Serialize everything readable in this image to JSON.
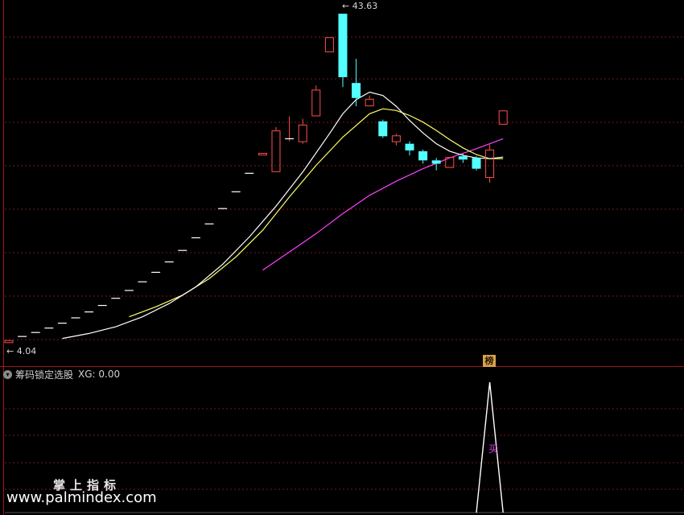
{
  "main_panel": {
    "high_label": "43.63",
    "low_label": "4.04"
  },
  "indicator": {
    "name": "筹码锁定选股",
    "value_label": "XG: 0.00",
    "badge": "榜",
    "signal_label": "买"
  },
  "watermark": {
    "line1": "掌上指标",
    "line2": "www.palmindex.com"
  },
  "colors": {
    "up": "#ff4d4d",
    "down": "#54ffff",
    "ma_short": "#ffffff",
    "ma_mid": "#ffff66",
    "ma_long": "#ff40ff",
    "grid": "#7a1a1a",
    "signal": "#ffffff"
  },
  "chart_data": [
    {
      "type": "candlestick",
      "ylim": [
        3.5,
        44.5
      ],
      "high": 43.63,
      "low": 4.04,
      "candles": [
        {
          "o": 4.05,
          "h": 4.4,
          "l": 4.04,
          "c": 4.4
        },
        {
          "o": 4.84,
          "h": 4.84,
          "l": 4.84,
          "c": 4.84
        },
        {
          "o": 5.32,
          "h": 5.32,
          "l": 5.32,
          "c": 5.32
        },
        {
          "o": 5.85,
          "h": 5.85,
          "l": 5.85,
          "c": 5.85
        },
        {
          "o": 6.44,
          "h": 6.44,
          "l": 6.44,
          "c": 6.44
        },
        {
          "o": 7.08,
          "h": 7.08,
          "l": 7.08,
          "c": 7.08
        },
        {
          "o": 7.79,
          "h": 7.79,
          "l": 7.79,
          "c": 7.79
        },
        {
          "o": 8.57,
          "h": 8.57,
          "l": 8.57,
          "c": 8.57
        },
        {
          "o": 9.43,
          "h": 9.43,
          "l": 9.43,
          "c": 9.43
        },
        {
          "o": 10.37,
          "h": 10.37,
          "l": 10.37,
          "c": 10.37
        },
        {
          "o": 11.41,
          "h": 11.41,
          "l": 11.41,
          "c": 11.41
        },
        {
          "o": 12.55,
          "h": 12.55,
          "l": 12.55,
          "c": 12.55
        },
        {
          "o": 13.8,
          "h": 13.8,
          "l": 13.8,
          "c": 13.8
        },
        {
          "o": 15.18,
          "h": 15.18,
          "l": 15.18,
          "c": 15.18
        },
        {
          "o": 16.7,
          "h": 16.7,
          "l": 16.7,
          "c": 16.7
        },
        {
          "o": 18.37,
          "h": 18.37,
          "l": 18.37,
          "c": 18.37
        },
        {
          "o": 20.21,
          "h": 20.21,
          "l": 20.21,
          "c": 20.21
        },
        {
          "o": 22.23,
          "h": 22.23,
          "l": 22.23,
          "c": 22.23
        },
        {
          "o": 24.45,
          "h": 24.45,
          "l": 24.45,
          "c": 24.45
        },
        {
          "o": 26.6,
          "h": 26.9,
          "l": 26.6,
          "c": 26.9
        },
        {
          "o": 24.6,
          "h": 30.0,
          "l": 24.6,
          "c": 29.6
        },
        {
          "o": 28.6,
          "h": 31.3,
          "l": 28.3,
          "c": 28.6
        },
        {
          "o": 28.2,
          "h": 31.0,
          "l": 28.0,
          "c": 30.3
        },
        {
          "o": 31.3,
          "h": 35.0,
          "l": 31.3,
          "c": 34.5
        },
        {
          "o": 39.0,
          "h": 40.8,
          "l": 39.0,
          "c": 40.8
        },
        {
          "o": 43.63,
          "h": 43.63,
          "l": 34.8,
          "c": 36.0
        },
        {
          "o": 35.3,
          "h": 38.2,
          "l": 32.5,
          "c": 33.5
        },
        {
          "o": 32.5,
          "h": 33.8,
          "l": 32.5,
          "c": 33.4
        },
        {
          "o": 30.7,
          "h": 30.9,
          "l": 28.7,
          "c": 28.9
        },
        {
          "o": 28.2,
          "h": 29.2,
          "l": 27.8,
          "c": 29.0
        },
        {
          "o": 28.0,
          "h": 28.3,
          "l": 26.6,
          "c": 27.2
        },
        {
          "o": 27.1,
          "h": 27.3,
          "l": 25.6,
          "c": 26.0
        },
        {
          "o": 26.0,
          "h": 26.3,
          "l": 24.8,
          "c": 25.6
        },
        {
          "o": 25.1,
          "h": 26.4,
          "l": 25.1,
          "c": 26.4
        },
        {
          "o": 26.5,
          "h": 26.8,
          "l": 25.7,
          "c": 26.1
        },
        {
          "o": 26.3,
          "h": 26.5,
          "l": 24.8,
          "c": 25.0
        },
        {
          "o": 23.9,
          "h": 27.9,
          "l": 23.3,
          "c": 27.3
        },
        {
          "o": 30.3,
          "h": 32.0,
          "l": 30.3,
          "c": 32.0
        }
      ],
      "ma_short": [
        [
          4,
          4.6
        ],
        [
          6,
          5.2
        ],
        [
          8,
          6.0
        ],
        [
          10,
          7.2
        ],
        [
          12,
          8.8
        ],
        [
          14,
          10.8
        ],
        [
          16,
          13.5
        ],
        [
          18,
          16.8
        ],
        [
          20,
          20.5
        ],
        [
          22,
          24.6
        ],
        [
          24,
          29.2
        ],
        [
          25,
          31.6
        ],
        [
          26,
          33.3
        ],
        [
          27,
          34.2
        ],
        [
          28,
          33.8
        ],
        [
          29,
          32.5
        ],
        [
          30,
          30.8
        ],
        [
          31,
          29.3
        ],
        [
          32,
          28.0
        ],
        [
          33,
          27.1
        ],
        [
          34,
          26.6
        ],
        [
          35,
          26.3
        ],
        [
          36,
          26.2
        ],
        [
          37,
          26.4
        ]
      ],
      "ma_mid": [
        [
          9,
          7.2
        ],
        [
          11,
          8.4
        ],
        [
          13,
          9.8
        ],
        [
          15,
          11.8
        ],
        [
          17,
          14.4
        ],
        [
          19,
          17.6
        ],
        [
          21,
          21.6
        ],
        [
          23,
          25.4
        ],
        [
          25,
          28.8
        ],
        [
          27,
          31.6
        ],
        [
          28,
          32.2
        ],
        [
          29,
          32.0
        ],
        [
          30,
          31.4
        ],
        [
          31,
          30.6
        ],
        [
          32,
          29.6
        ],
        [
          33,
          28.5
        ],
        [
          34,
          27.5
        ],
        [
          35,
          26.7
        ],
        [
          36,
          26.2
        ],
        [
          37,
          26.2
        ]
      ],
      "ma_long": [
        [
          19,
          12.8
        ],
        [
          21,
          15.0
        ],
        [
          23,
          17.2
        ],
        [
          25,
          19.6
        ],
        [
          27,
          21.8
        ],
        [
          29,
          23.5
        ],
        [
          31,
          25.0
        ],
        [
          33,
          26.3
        ],
        [
          35,
          27.4
        ],
        [
          37,
          28.6
        ]
      ]
    },
    {
      "type": "line",
      "title": "筹码锁定选股",
      "ylim": [
        0,
        1
      ],
      "signal": [
        [
          35,
          0
        ],
        [
          36,
          1
        ],
        [
          37,
          0
        ]
      ]
    }
  ]
}
